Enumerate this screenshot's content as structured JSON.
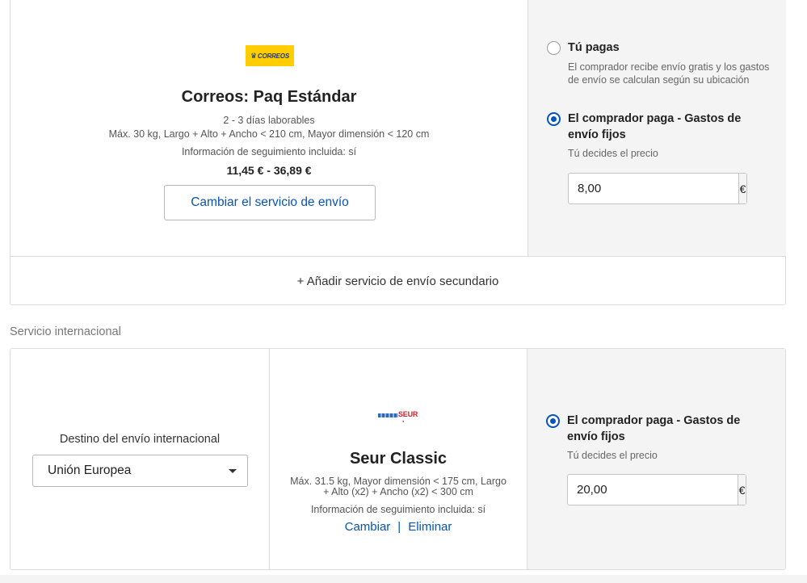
{
  "domestic": {
    "logo_text": "CORREOS",
    "service_title": "Correos: Paq Estándar",
    "delivery_time": "2 - 3 días laborables",
    "limits": "Máx. 30 kg, Largo + Alto + Ancho < 210 cm, Mayor dimensión < 120 cm",
    "tracking": "Información de seguimiento incluida: sí",
    "price_range": "11,45 € - 36,89 €",
    "change_button": "Cambiar el servicio de envío",
    "options": {
      "buyer_free": {
        "title": "Tú pagas",
        "description_line1": "El comprador recibe envío gratis y los gastos",
        "description_line2": "de envío se calculan según su ubicación",
        "checked": false
      },
      "buyer_pays": {
        "title_line1": "El comprador paga - Gastos de",
        "title_line2": "envío fijos",
        "description": "Tú decides el precio",
        "checked": true
      }
    },
    "price_value": "8,00",
    "currency_symbol": "€",
    "add_secondary": "+ Añadir servicio de envío secundario"
  },
  "international": {
    "section_label": "Servicio internacional",
    "destination_label": "Destino del envío internacional",
    "destination_value": "Unión Europea",
    "logo_text": "SEUR",
    "service_title": "Seur Classic",
    "limits_line1": "Máx. 31.5 kg, Mayor dimensión < 175 cm, Largo",
    "limits_line2": "+ Alto (x2) + Ancho (x2) < 300 cm",
    "tracking": "Información de seguimiento incluida: sí",
    "change_link": "Cambiar",
    "link_separator": "|",
    "delete_link": "Eliminar",
    "buyer_pays": {
      "title_line1": "El comprador paga - Gastos de",
      "title_line2": "envío fijos",
      "description": "Tú decides el precio",
      "checked": true
    },
    "price_value": "20,00",
    "currency_symbol": "€"
  },
  "colors": {
    "link_blue": "#0654ba",
    "correos_yellow": "#ffcd00",
    "seur_red": "#d3202a",
    "panel_gray": "#f4f4f4",
    "border": "#dcdcdc"
  }
}
